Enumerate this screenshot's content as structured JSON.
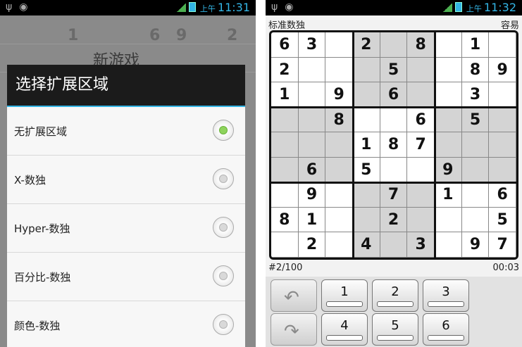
{
  "status_left": {
    "icons": [
      "usb-icon",
      "android-icon"
    ],
    "time": "11:31",
    "ampm": "上午"
  },
  "status_right": {
    "icons": [
      "usb-icon",
      "android-icon"
    ],
    "time": "11:32",
    "ampm": "上午"
  },
  "left_background": {
    "title": "新游戏",
    "numbers": [
      "1",
      "6",
      "9",
      "2"
    ]
  },
  "dialog": {
    "title": "选择扩展区域",
    "options": [
      {
        "label": "无扩展区域",
        "selected": true
      },
      {
        "label": "X-数独",
        "selected": false
      },
      {
        "label": "Hyper-数独",
        "selected": false
      },
      {
        "label": "百分比-数独",
        "selected": false
      },
      {
        "label": "颜色-数独",
        "selected": false
      }
    ]
  },
  "game": {
    "mode": "标准数独",
    "difficulty": "容易",
    "puzzle_index": "#2/100",
    "timer": "00:03",
    "grid": [
      [
        "6",
        "3",
        "",
        "2",
        "",
        "8",
        "",
        "1",
        ""
      ],
      [
        "2",
        "",
        "",
        "",
        "5",
        "",
        "",
        "8",
        "9"
      ],
      [
        "1",
        "",
        "9",
        "",
        "6",
        "",
        "",
        "3",
        ""
      ],
      [
        "",
        "",
        "8",
        "",
        "",
        "6",
        "",
        "5",
        ""
      ],
      [
        "",
        "",
        "",
        "1",
        "8",
        "7",
        "",
        "",
        ""
      ],
      [
        "",
        "6",
        "",
        "5",
        "",
        "",
        "9",
        "",
        ""
      ],
      [
        "",
        "9",
        "",
        "",
        "7",
        "",
        "1",
        "",
        "6"
      ],
      [
        "8",
        "1",
        "",
        "",
        "2",
        "",
        "",
        "",
        "5"
      ],
      [
        "",
        "2",
        "",
        "4",
        "",
        "3",
        "",
        "9",
        "7"
      ]
    ],
    "keys": [
      "1",
      "2",
      "3",
      "4",
      "5",
      "6"
    ],
    "undo_icon": "undo-icon",
    "redo_icon": "redo-icon"
  }
}
